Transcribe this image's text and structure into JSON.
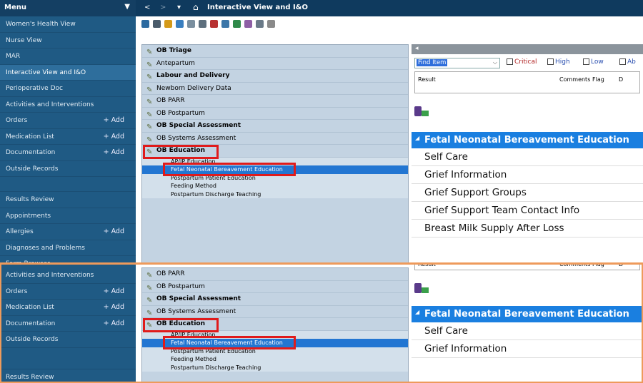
{
  "sidebar": {
    "title": "Menu",
    "top_items": [
      {
        "label": "Women's Health View"
      },
      {
        "label": "Nurse View"
      },
      {
        "label": "MAR"
      },
      {
        "label": "Interactive View and I&O",
        "active": true
      },
      {
        "label": "Perioperative Doc"
      },
      {
        "label": "Activities and Interventions"
      },
      {
        "label": "Orders",
        "add": "+ Add"
      },
      {
        "label": "Medication List",
        "add": "+ Add"
      },
      {
        "label": "Documentation",
        "add": "+ Add"
      },
      {
        "label": "Outside Records"
      }
    ],
    "lower_items": [
      {
        "label": "Results Review"
      },
      {
        "label": "Appointments"
      },
      {
        "label": "Allergies",
        "add": "+ Add"
      },
      {
        "label": "Diagnoses and Problems"
      },
      {
        "label": "Form Browser"
      }
    ],
    "bottom_items": [
      {
        "label": "Activities and Interventions"
      },
      {
        "label": "Orders",
        "add": "+ Add"
      },
      {
        "label": "Medication List",
        "add": "+ Add"
      },
      {
        "label": "Documentation",
        "add": "+ Add"
      },
      {
        "label": "Outside Records"
      }
    ],
    "bottom_last": "Results Review"
  },
  "topbar": {
    "title": "Interactive View and I&O",
    "back": "<",
    "forward": ">",
    "dropdown": "▾",
    "home_icon": "home-icon"
  },
  "tree": {
    "bands": [
      {
        "label": "OB Triage",
        "bold": true
      },
      {
        "label": "Antepartum"
      },
      {
        "label": "Labour and Delivery",
        "bold": true
      },
      {
        "label": "Newborn Delivery Data"
      },
      {
        "label": "OB PARR"
      },
      {
        "label": "OB Postpartum"
      },
      {
        "label": "OB Special Assessment",
        "bold": true
      },
      {
        "label": "OB Systems Assessment"
      },
      {
        "label": "OB Education",
        "bold": true
      }
    ],
    "sub_items": [
      {
        "label": "AP/IP Education"
      },
      {
        "label": "Fetal Neonatal Bereavement Education",
        "selected": true
      },
      {
        "label": "Postpartum Patient Education"
      },
      {
        "label": "Feeding Method"
      },
      {
        "label": "Postpartum Discharge Teaching"
      }
    ],
    "bottom_bands": [
      {
        "label": "OB PARR"
      },
      {
        "label": "OB Postpartum"
      },
      {
        "label": "OB Special Assessment",
        "bold": true
      },
      {
        "label": "OB Systems Assessment"
      },
      {
        "label": "OB Education",
        "bold": true
      }
    ]
  },
  "filter": {
    "find_item": "Find Item",
    "checks": [
      "Critical",
      "High",
      "Low",
      "Ab"
    ],
    "columns": [
      "Result",
      "Comments",
      "Flag",
      "D"
    ]
  },
  "education": {
    "header": "Fetal Neonatal Bereavement Education",
    "items": [
      "Self Care",
      "Grief Information",
      "Grief Support Groups",
      "Grief Support Team Contact Info",
      "Breast Milk Supply After Loss"
    ],
    "bottom_items": [
      "Self Care",
      "Grief Information"
    ]
  },
  "colors": {
    "sidebar": "#1f5a84",
    "topbar": "#0f3a5e",
    "accent": "#1a7fe0",
    "highlight": "#e01b1b",
    "split": "#ee9a5b"
  }
}
